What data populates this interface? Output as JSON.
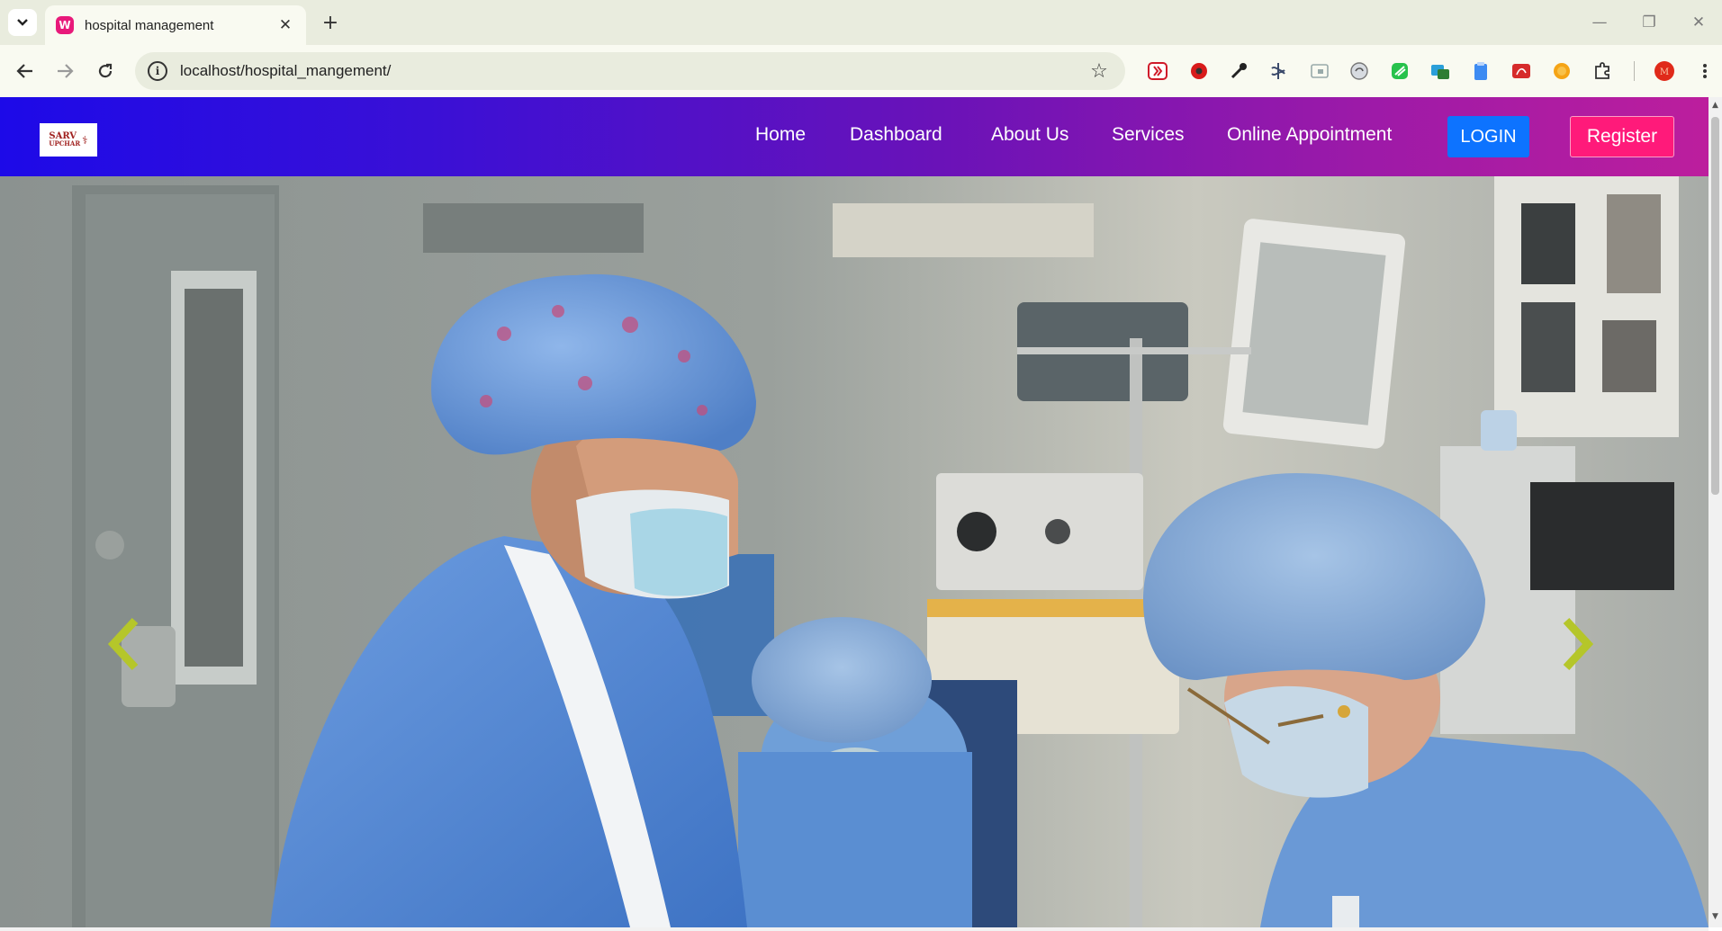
{
  "browser": {
    "tab": {
      "title": "hospital management",
      "favicon": "wamp-server-icon"
    },
    "omnibox": {
      "url": "localhost/hospital_mangement/"
    },
    "extensions": [
      "youtube-ext-icon",
      "record-icon",
      "eyedropper-icon",
      "scribble-icon",
      "window-icon",
      "coin-icon",
      "leaf-icon",
      "translate-icon",
      "clipboard-icon",
      "pdf-icon",
      "orange-icon",
      "puzzle-icon",
      "profile-avatar-icon"
    ],
    "accent": "#e8197a"
  },
  "site": {
    "logo": {
      "line1": "SARV",
      "line2": "UPCHAR"
    },
    "nav": {
      "home": "Home",
      "dashboard": "Dashboard",
      "about": "About Us",
      "services": "Services",
      "appointment": "Online Appointment",
      "login": "LOGIN",
      "register": "Register"
    },
    "colors": {
      "nav_start": "#1d0ae8",
      "nav_end": "#bc1e9d",
      "login": "#0d73ff",
      "register": "#ff1a7a",
      "carousel_arrow": "#b5c62a"
    }
  },
  "hero": {
    "image": "surgeons-in-operating-room-photo",
    "prev_icon": "chevron-left-icon",
    "next_icon": "chevron-right-icon"
  }
}
